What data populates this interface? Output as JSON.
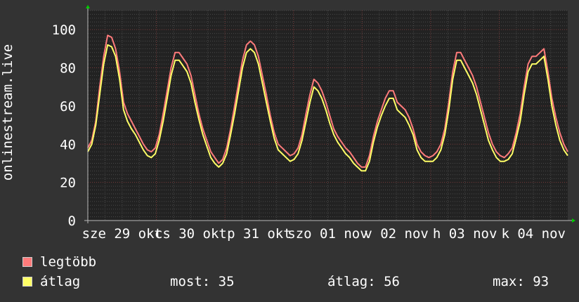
{
  "chart_data": {
    "type": "line",
    "ylabel": "onlinestream.live",
    "ylim": [
      0,
      110
    ],
    "y_ticks": [
      "0",
      "20",
      "40",
      "60",
      "80",
      "100"
    ],
    "x_tick_labels": [
      "sze 29 okt",
      "cs 30 okt",
      "p 31 okt",
      "szo 01 nov",
      "v 02 nov",
      "h 03 nov",
      "k 04 nov"
    ],
    "grid": true,
    "colors": {
      "background": "#333333",
      "plot_bg": "#222222",
      "major_grid": "#7a3c3c",
      "minor_grid": "#4a4a4a",
      "axis": "#bbbbbb",
      "arrow": "#00cc00",
      "max_line": "#ff7b7b",
      "avg_line": "#ffff66"
    },
    "series": [
      {
        "name": "legtöbb",
        "color": "#ff7b7b",
        "values": [
          38,
          42,
          52,
          70,
          86,
          97,
          96,
          90,
          78,
          62,
          56,
          52,
          48,
          44,
          40,
          37,
          36,
          38,
          45,
          56,
          68,
          80,
          88,
          88,
          85,
          82,
          76,
          66,
          56,
          48,
          42,
          36,
          33,
          30,
          32,
          38,
          48,
          60,
          72,
          84,
          92,
          94,
          92,
          86,
          76,
          66,
          55,
          46,
          40,
          38,
          36,
          34,
          35,
          38,
          45,
          56,
          66,
          74,
          72,
          68,
          62,
          55,
          48,
          44,
          41,
          38,
          36,
          33,
          30,
          28,
          28,
          34,
          44,
          52,
          58,
          64,
          68,
          68,
          62,
          60,
          58,
          54,
          48,
          40,
          36,
          34,
          33,
          34,
          36,
          40,
          48,
          62,
          78,
          88,
          88,
          84,
          80,
          76,
          70,
          62,
          54,
          46,
          40,
          36,
          34,
          33,
          35,
          38,
          46,
          56,
          70,
          82,
          86,
          86,
          88,
          90,
          78,
          64,
          54,
          46,
          40,
          36
        ]
      },
      {
        "name": "átlag",
        "color": "#ffff66",
        "values": [
          36,
          40,
          50,
          66,
          82,
          92,
          91,
          86,
          74,
          58,
          52,
          48,
          45,
          41,
          37,
          34,
          33,
          35,
          42,
          52,
          64,
          76,
          84,
          84,
          81,
          78,
          72,
          62,
          53,
          45,
          39,
          33,
          30,
          28,
          30,
          35,
          45,
          56,
          68,
          80,
          88,
          90,
          88,
          82,
          72,
          62,
          52,
          43,
          37,
          35,
          33,
          31,
          32,
          35,
          42,
          52,
          62,
          70,
          68,
          64,
          58,
          51,
          45,
          41,
          38,
          35,
          33,
          30,
          28,
          26,
          26,
          31,
          41,
          49,
          55,
          60,
          64,
          64,
          58,
          56,
          54,
          50,
          45,
          37,
          33,
          31,
          31,
          31,
          33,
          37,
          45,
          58,
          74,
          84,
          84,
          80,
          76,
          72,
          66,
          58,
          50,
          42,
          37,
          33,
          31,
          31,
          32,
          35,
          43,
          52,
          66,
          78,
          82,
          82,
          84,
          86,
          74,
          60,
          50,
          42,
          37,
          34
        ]
      }
    ]
  },
  "legend": {
    "max_label": "legtöbb",
    "avg_label": "átlag",
    "now_text": "most: 35",
    "avg_text": "átlag: 56",
    "max_text": "max: 93"
  }
}
